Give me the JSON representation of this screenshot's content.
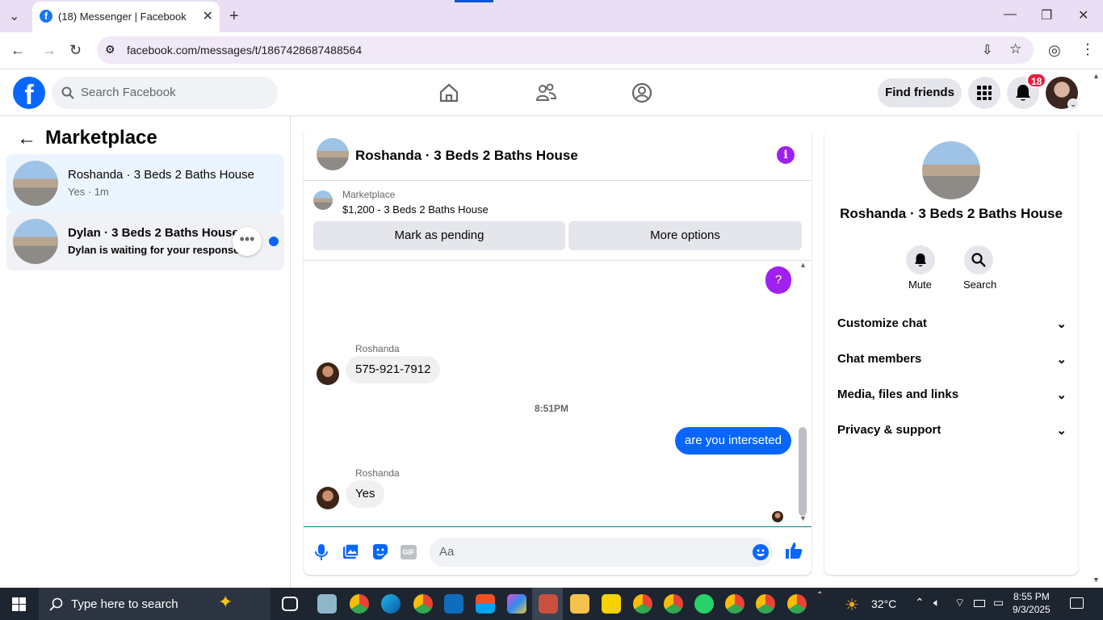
{
  "browser": {
    "tab_title": "(18) Messenger | Facebook",
    "url": "facebook.com/messages/t/1867428687488564"
  },
  "facebook": {
    "search_placeholder": "Search Facebook",
    "find_friends_label": "Find friends",
    "notification_count": "18"
  },
  "left": {
    "title": "Marketplace",
    "conversations": [
      {
        "name": "Roshanda · 3 Beds 2 Baths House",
        "preview": "Yes · 1m"
      },
      {
        "name": "Dylan · 3 Beds 2 Baths House",
        "preview": "Dylan is waiting for your response."
      }
    ]
  },
  "chat": {
    "title": "Roshanda · 3 Beds 2 Baths House",
    "listing_source": "Marketplace",
    "listing_text": "$1,200 - 3 Beds 2 Baths House",
    "mark_pending_label": "Mark as pending",
    "more_options_label": "More options",
    "top_bubble": "?",
    "messages": [
      {
        "sender": "Roshanda",
        "text": "575-921-7912"
      },
      {
        "timestamp": "8:51PM"
      },
      {
        "sender": "me",
        "text": "are you interseted"
      },
      {
        "sender": "Roshanda",
        "text": "Yes"
      }
    ],
    "input_placeholder": "Aa"
  },
  "right": {
    "title": "Roshanda · 3 Beds 2 Baths House",
    "mute_label": "Mute",
    "search_label": "Search",
    "sections": [
      "Customize chat",
      "Chat members",
      "Media, files and links",
      "Privacy & support"
    ]
  },
  "taskbar": {
    "search_placeholder": "Type here to search",
    "temperature": "32°C",
    "time": "8:55 PM",
    "date": "9/3/2025"
  },
  "colors": {
    "fb_blue": "#0866ff",
    "accent_purple": "#a020f0",
    "badge_red": "#e41e3f"
  }
}
